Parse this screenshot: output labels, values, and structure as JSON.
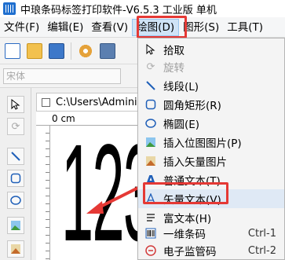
{
  "window": {
    "title": "中琅条码标签打印软件-V6.5.3 工业版 单机"
  },
  "menubar": {
    "items": [
      {
        "label": "文件(F)"
      },
      {
        "label": "编辑(E)"
      },
      {
        "label": "查看(V)"
      },
      {
        "label": "绘图(D)"
      },
      {
        "label": "图形(S)"
      },
      {
        "label": "工具(T)"
      }
    ]
  },
  "fontbar": {
    "font_value": "宋体"
  },
  "document": {
    "path": "C:\\Users\\Administ",
    "ruler_unit": "0 cm",
    "canvas_text": "123"
  },
  "draw_menu": {
    "items": [
      {
        "label": "拾取",
        "icon": "cursor-icon",
        "enabled": true,
        "shortcut": ""
      },
      {
        "label": "旋转",
        "icon": "rotate-icon",
        "enabled": false,
        "shortcut": ""
      },
      {
        "label": "线段(L)",
        "icon": "line-icon",
        "enabled": true,
        "shortcut": ""
      },
      {
        "label": "圆角矩形(R)",
        "icon": "rounded-rect-icon",
        "enabled": true,
        "shortcut": ""
      },
      {
        "label": "椭圆(E)",
        "icon": "ellipse-icon",
        "enabled": true,
        "shortcut": ""
      },
      {
        "label": "插入位图图片(P)",
        "icon": "bitmap-icon",
        "enabled": true,
        "shortcut": ""
      },
      {
        "label": "插入矢量图片",
        "icon": "vector-image-icon",
        "enabled": true,
        "shortcut": ""
      },
      {
        "label": "普通文本(T)",
        "icon": "text-icon",
        "enabled": true,
        "shortcut": ""
      },
      {
        "label": "矢量文本(V)",
        "icon": "vector-text-icon",
        "enabled": true,
        "shortcut": ""
      },
      {
        "label": "富文本(H)",
        "icon": "rich-text-icon",
        "enabled": true,
        "shortcut": ""
      },
      {
        "label": "一维条码",
        "icon": "barcode-icon",
        "enabled": true,
        "shortcut": "Ctrl-1"
      },
      {
        "label": "电子监管码",
        "icon": "supervision-code-icon",
        "enabled": true,
        "shortcut": "Ctrl-2"
      }
    ]
  },
  "colors": {
    "highlight_red": "#e53935",
    "menu_open_bg": "#cfe3f6",
    "icon_blue": "#1f5fb8"
  }
}
